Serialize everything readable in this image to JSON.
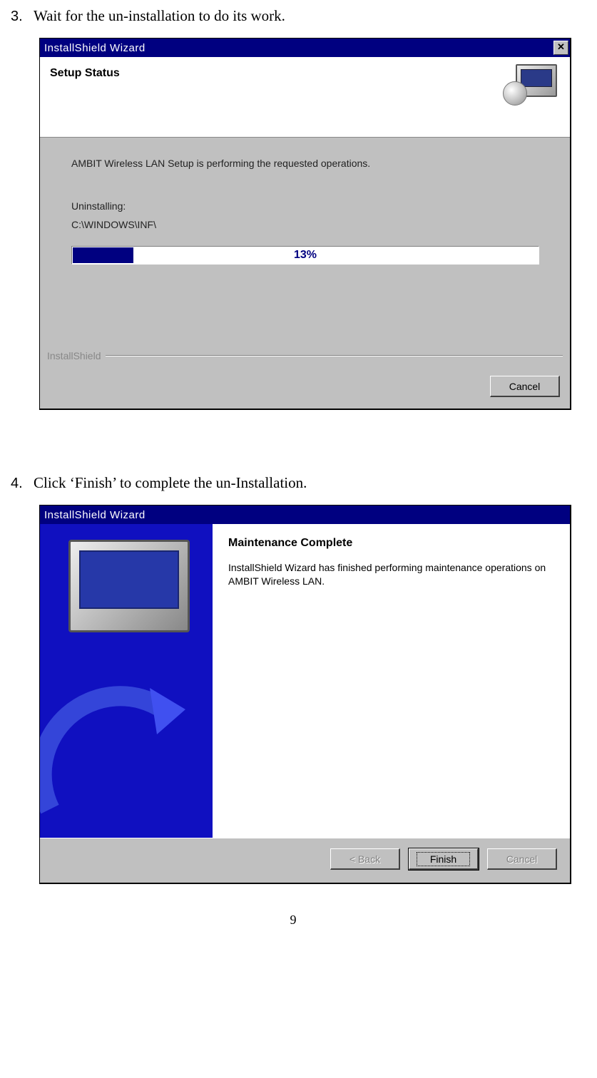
{
  "steps": {
    "s3": {
      "num": "3.",
      "text": "Wait for the un-installation to do its work."
    },
    "s4": {
      "num": "4.",
      "text": "Click ‘Finish’ to complete the un-Installation."
    }
  },
  "dialog1": {
    "title": "InstallShield Wizard",
    "status_heading": "Setup Status",
    "body_line1": "AMBIT Wireless LAN Setup is performing the requested operations.",
    "uninstalling_label": "Uninstalling:",
    "path": "C:\\WINDOWS\\INF\\",
    "progress_percent": "13%",
    "progress_value": 13,
    "brand": "InstallShield",
    "cancel_label": "Cancel"
  },
  "dialog2": {
    "title": "InstallShield Wizard",
    "heading": "Maintenance Complete",
    "body": "InstallShield Wizard has finished performing maintenance operations on AMBIT Wireless LAN.",
    "back_label": "< Back",
    "finish_label": "Finish",
    "cancel_label": "Cancel"
  },
  "page_number": "9"
}
